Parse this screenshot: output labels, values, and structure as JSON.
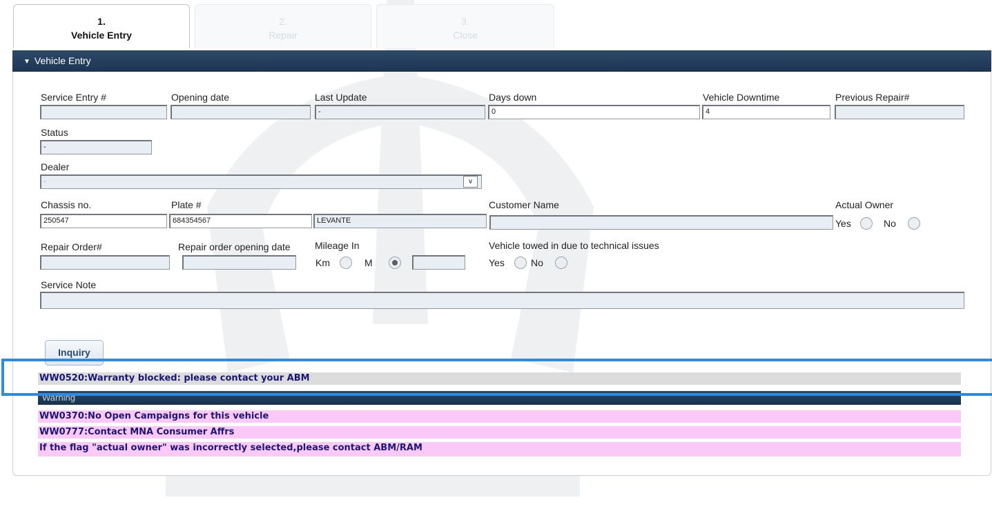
{
  "steps": [
    {
      "number": "1.",
      "label": "Vehicle Entry"
    },
    {
      "number": "2.",
      "label": "Repair"
    },
    {
      "number": "3.",
      "label": "Close"
    }
  ],
  "panel": {
    "title": "Vehicle Entry"
  },
  "form": {
    "service_entry": {
      "label": "Service Entry #",
      "value": ""
    },
    "opening_date": {
      "label": "Opening date",
      "value": ""
    },
    "last_update": {
      "label": "Last Update",
      "value": "-"
    },
    "days_down": {
      "label": "Days down",
      "value": "0"
    },
    "vehicle_downtime": {
      "label": "Vehicle Downtime",
      "value": "4"
    },
    "previous_repair": {
      "label": "Previous Repair#",
      "value": ""
    },
    "status": {
      "label": "Status",
      "value": "-"
    },
    "dealer": {
      "label": "Dealer",
      "value": "-"
    },
    "chassis": {
      "label": "Chassis no.",
      "value": "250547"
    },
    "plate": {
      "label": "Plate #",
      "value": "684354567"
    },
    "model": {
      "value": "LEVANTE"
    },
    "customer_name": {
      "label": "Customer Name",
      "value": ""
    },
    "actual_owner": {
      "label": "Actual Owner",
      "yes": "Yes",
      "no": "No"
    },
    "repair_order": {
      "label": "Repair Order#",
      "value": ""
    },
    "repair_order_date": {
      "label": "Repair order opening date",
      "value": ""
    },
    "mileage": {
      "label": "Mileage In",
      "km": "Km",
      "m": "M",
      "selected": "M",
      "value": ""
    },
    "towed": {
      "label": "Vehicle towed in due to technical issues",
      "yes": "Yes",
      "no": "No"
    },
    "service_note": {
      "label": "Service Note",
      "value": ""
    }
  },
  "inquiry_button": "Inquiry",
  "messages": {
    "blocked": "WW0520:Warranty blocked: please contact your ABM",
    "warning_header": "Warning",
    "warnings": [
      "WW0370:No Open Campaigns for this vehicle",
      "WW0777:Contact MNA Consumer Affrs",
      "If the flag \"actual owner\" was incorrectly selected,please contact ABM/RAM"
    ]
  },
  "colors": {
    "header": "#1d3553",
    "highlight": "#2f8be0",
    "warning_bg": "#fbc9f7",
    "blocked_bg": "#dcdcdc",
    "message_text": "#1a1677"
  }
}
